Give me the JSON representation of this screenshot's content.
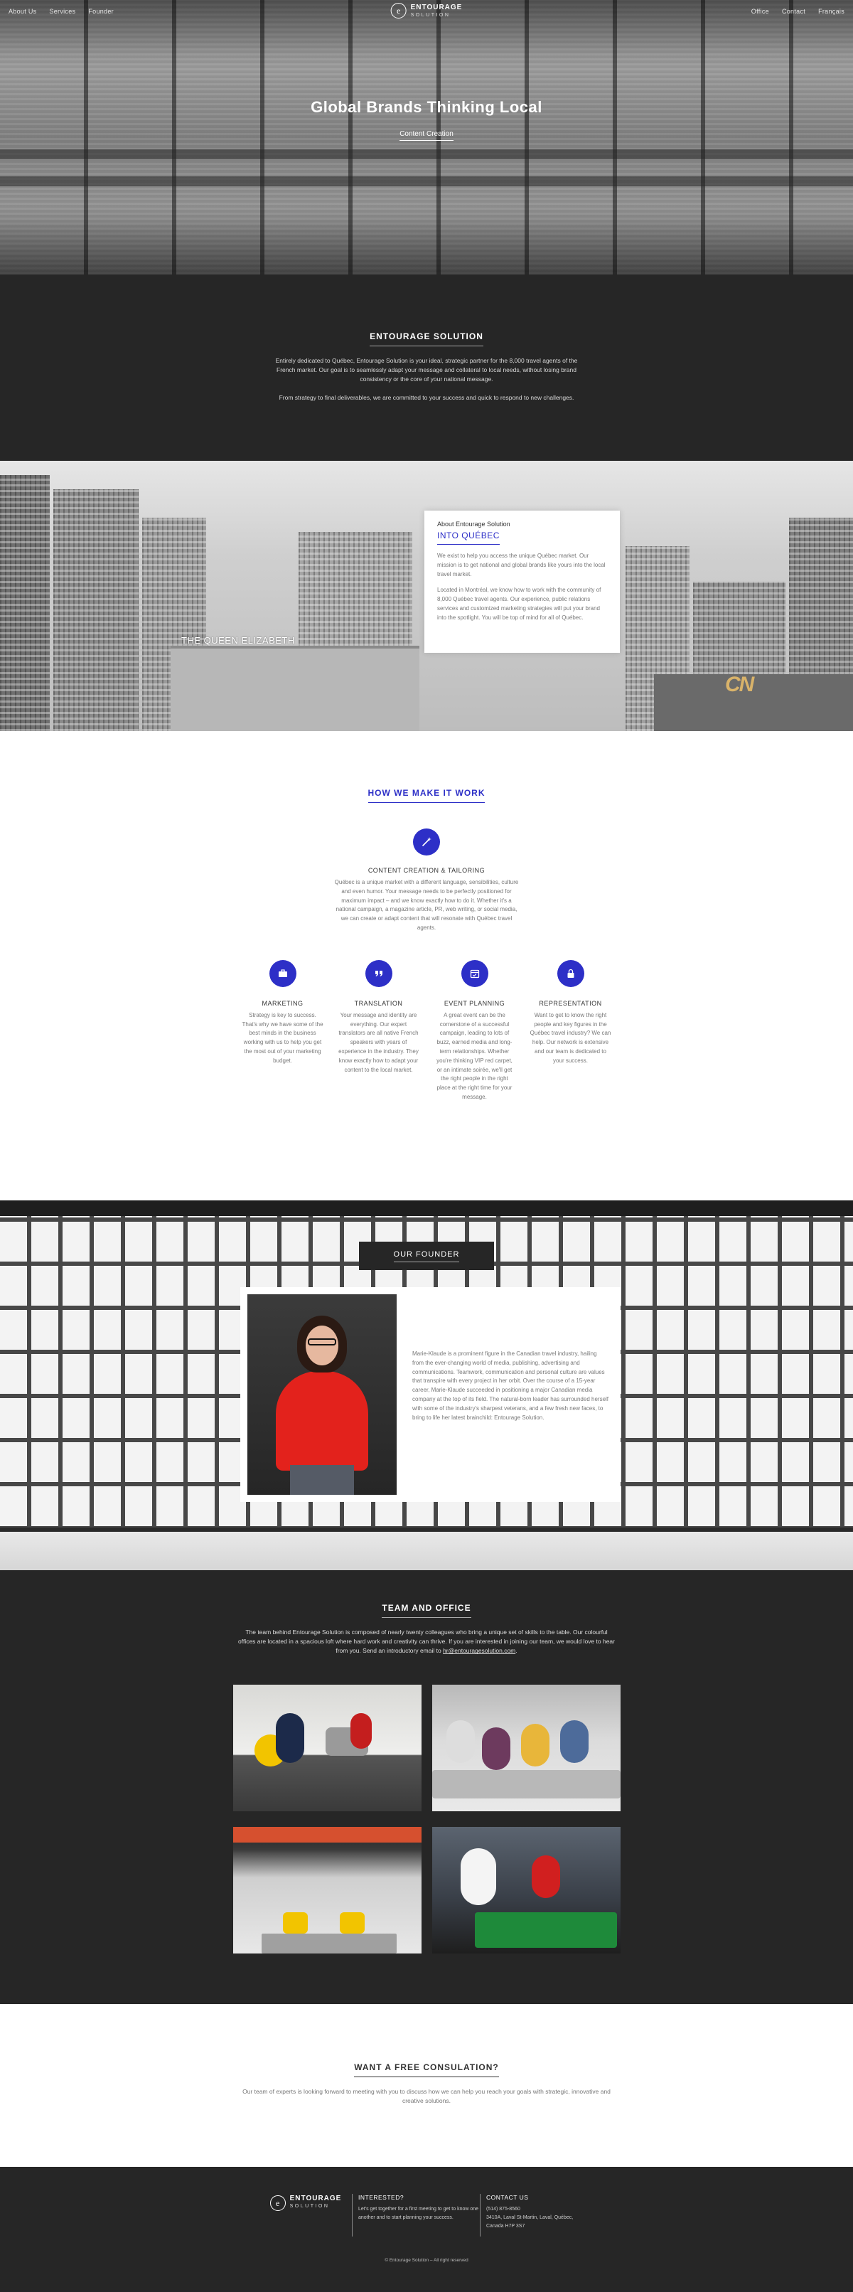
{
  "nav": {
    "left": [
      "About Us",
      "Services",
      "Founder"
    ],
    "right": [
      "Office",
      "Contact",
      "Français"
    ],
    "brand_name": "ENTOURAGE",
    "brand_sub": "SOLUTION"
  },
  "hero": {
    "title": "Global Brands Thinking Local",
    "subtitle": "Content Creation"
  },
  "intro": {
    "heading": "ENTOURAGE SOLUTION",
    "paragraph1": "Entirely dedicated to Québec, Entourage Solution is your ideal, strategic partner for the 8,000 travel agents of the French market. Our goal is to seamlessly adapt your message and collateral to local needs, without losing brand consistency or the core of your national message.",
    "paragraph2": "From strategy to final deliverables, we are committed to your success and quick to respond to new challenges."
  },
  "city": {
    "kicker": "About Entourage Solution",
    "title": "INTO QUÉBEC",
    "paragraph1": "We exist to help you access the unique Québec market. Our mission is to get national and global brands like yours into the local travel market.",
    "paragraph2": "Located in Montréal, we know how to work with the community of 8,000 Québec travel agents. Our experience, public relations services and customized marketing strategies will put your brand into the spotlight. You will be top of mind for all of Québec.",
    "sign_queen": "THE QUEEN ELIZABETH",
    "sign_cn": "CN"
  },
  "how": {
    "heading": "HOW WE MAKE IT WORK",
    "main": {
      "icon": "magic-wand-icon",
      "title": "CONTENT CREATION & TAILORING",
      "text": "Québec is a unique market with a different language, sensibilities, culture and even humor. Your message needs to be perfectly positioned for maximum impact – and we know exactly how to do it. Whether it's a national campaign, a magazine article, PR, web writing, or social media, we can create or adapt content that will resonate with Québec travel agents."
    },
    "features": [
      {
        "icon": "briefcase-icon",
        "title": "MARKETING",
        "text": "Strategy is key to success. That's why we have some of the best minds in the business working with us to help you get the most out of your marketing budget."
      },
      {
        "icon": "quote-icon",
        "title": "TRANSLATION",
        "text": "Your message and identity are everything. Our expert translators are all native French speakers with years of experience in the industry. They know exactly how to adapt your content to the local market."
      },
      {
        "icon": "calendar-icon",
        "title": "EVENT PLANNING",
        "text": "A great event can be the cornerstone of a successful campaign, leading to lots of buzz, earned media and long-term relationships. Whether you're thinking VIP red carpet, or an intimate soirée, we'll get the right people in the right place at the right time for your message."
      },
      {
        "icon": "lock-icon",
        "title": "REPRESENTATION",
        "text": "Want to get to know the right people and key figures in the Québec travel industry? We can help. Our network is extensive and our team is dedicated to your success."
      }
    ]
  },
  "founder": {
    "heading": "OUR FOUNDER",
    "text": "Marie-Klaude is a prominent figure in the Canadian travel industry, hailing from the ever-changing world of media, publishing, advertising and communications. Teamwork, communication and personal culture are values that transpire with every project in her orbit. Over the course of a 15-year career, Marie-Klaude succeeded in positioning a major Canadian media company at the top of its field. The natural-born leader has surrounded herself with some of the industry's sharpest veterans, and a few fresh new faces, to bring to life her latest brainchild: Entourage Solution."
  },
  "team": {
    "heading": "TEAM AND OFFICE",
    "text_before": "The team behind Entourage Solution is composed of nearly twenty colleagues who bring a unique set of skills to the table. Our colourful offices are located in a spacious loft where hard work and creativity can thrive. If you are interested in joining our team, we would love to hear from you. Send an introductory email to ",
    "email": "hr@entouragesolution.com",
    "text_after": "."
  },
  "consult": {
    "heading": "WANT A FREE CONSULATION?",
    "text": "Our team of experts is looking forward to meeting with you to discuss how we can help you reach your goals with strategic, innovative and creative solutions."
  },
  "footer": {
    "interested_heading": "INTERESTED?",
    "interested_text": "Let's get together for a first meeting to get to know one another and to start planning your success.",
    "contact_heading": "CONTACT US",
    "phone": "(514) 875-8560",
    "address1": "3410A, Laval St-Martin, Laval, Québec,",
    "address2": "Canada H7P 3S7",
    "copyright": "© Entourage Solution – All right reserved"
  },
  "colors": {
    "accent": "#2d2fc7",
    "dark": "#262626"
  }
}
